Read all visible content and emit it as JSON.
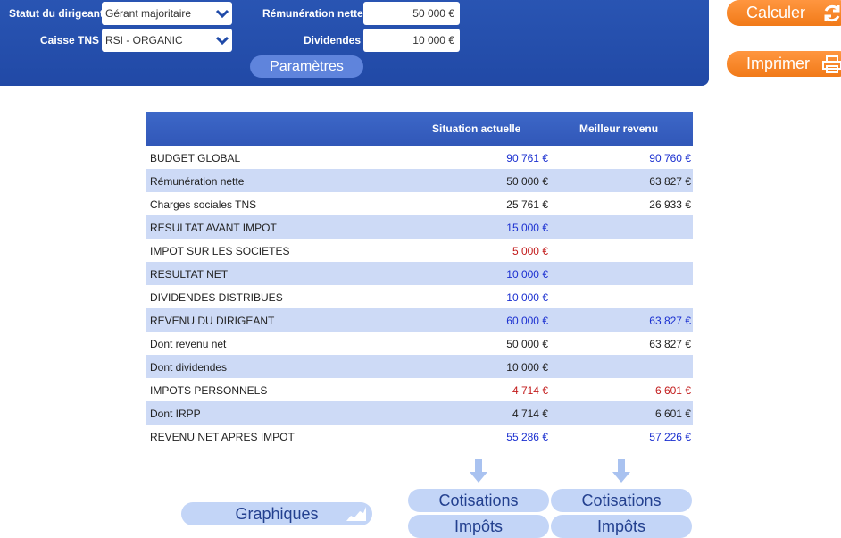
{
  "form": {
    "statut_label": "Statut du dirigeant",
    "statut_value": "Gérant majoritaire",
    "caisse_label": "Caisse TNS",
    "caisse_value": "RSI - ORGANIC",
    "remuneration_label": "Rémunération nette",
    "remuneration_value": "50 000 €",
    "dividendes_label": "Dividendes",
    "dividendes_value": "10 000 €",
    "parametres_label": "Paramètres"
  },
  "actions": {
    "calculer_label": "Calculer",
    "imprimer_label": "Imprimer"
  },
  "table": {
    "headers": [
      "",
      "Situation actuelle",
      "Meilleur revenu"
    ],
    "rows": [
      {
        "label": "BUDGET GLOBAL",
        "actuelle": "90 761 €",
        "meilleur": "90 760 €"
      },
      {
        "label": "Rémunération nette",
        "actuelle": "50 000 €",
        "meilleur": "63 827 €"
      },
      {
        "label": "Charges sociales TNS",
        "actuelle": "25 761 €",
        "meilleur": "26 933 €"
      },
      {
        "label": "RESULTAT AVANT IMPOT",
        "actuelle": "15 000 €",
        "meilleur": ""
      },
      {
        "label": "IMPOT SUR LES SOCIETES",
        "actuelle": "5 000 €",
        "meilleur": ""
      },
      {
        "label": "RESULTAT NET",
        "actuelle": "10 000 €",
        "meilleur": ""
      },
      {
        "label": "DIVIDENDES DISTRIBUES",
        "actuelle": "10 000 €",
        "meilleur": ""
      },
      {
        "label": "REVENU DU DIRIGEANT",
        "actuelle": "60 000 €",
        "meilleur": "63 827 €"
      },
      {
        "label": "Dont revenu net",
        "actuelle": "50 000 €",
        "meilleur": "63 827 €"
      },
      {
        "label": "Dont dividendes",
        "actuelle": "10 000 €",
        "meilleur": ""
      },
      {
        "label": "IMPOTS PERSONNELS",
        "actuelle": "4 714 €",
        "meilleur": "6 601 €"
      },
      {
        "label": "Dont IRPP",
        "actuelle": "4 714 €",
        "meilleur": "6 601 €"
      },
      {
        "label": "REVENU NET APRES IMPOT",
        "actuelle": "55 286 €",
        "meilleur": "57 226 €"
      }
    ]
  },
  "bottom": {
    "graphiques_label": "Graphiques",
    "cotisations_label_1": "Cotisations",
    "impots_label_1": "Impôts",
    "cotisations_label_2": "Cotisations",
    "impots_label_2": "Impôts"
  },
  "colors": {
    "panel_blue": "#2a56b4",
    "accent_orange": "#f17a18",
    "value_blue": "#1a2fd0",
    "value_red": "#c21a1a",
    "row_alt": "#cddaf6"
  }
}
